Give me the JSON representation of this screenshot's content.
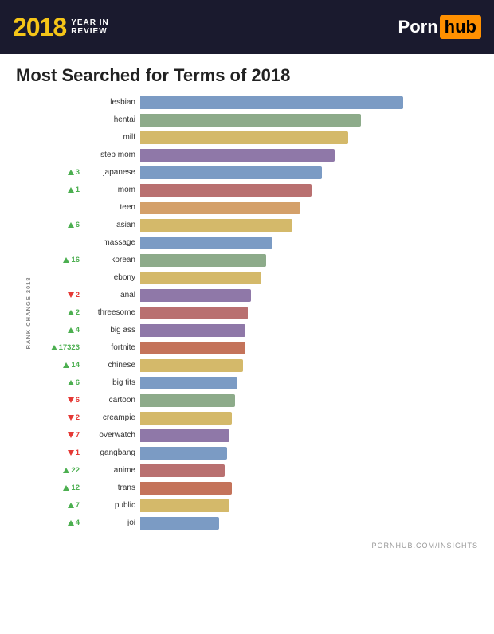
{
  "header": {
    "year": "2018",
    "yearSub1": "YEAR IN",
    "yearSub2": "REVIEW",
    "logoText1": "Porn",
    "logoText2": "hub"
  },
  "title": "Most Searched for Terms of 2018",
  "footer": "PORNHUB.COM/INSIGHTS",
  "axisLabel": "RANK CHANGE 2018",
  "bars": [
    {
      "term": "lesbian",
      "rankChange": null,
      "dir": "none",
      "pct": 100,
      "color": "#7b9bc4"
    },
    {
      "term": "hentai",
      "rankChange": null,
      "dir": "none",
      "pct": 84,
      "color": "#8dab8a"
    },
    {
      "term": "milf",
      "rankChange": null,
      "dir": "none",
      "pct": 79,
      "color": "#d4b96a"
    },
    {
      "term": "step mom",
      "rankChange": null,
      "dir": "none",
      "pct": 74,
      "color": "#8f78a8"
    },
    {
      "term": "japanese",
      "rankChange": 3,
      "dir": "up",
      "pct": 69,
      "color": "#7b9bc4"
    },
    {
      "term": "mom",
      "rankChange": 1,
      "dir": "up",
      "pct": 65,
      "color": "#b97070"
    },
    {
      "term": "teen",
      "rankChange": null,
      "dir": "none",
      "pct": 61,
      "color": "#d4a06a"
    },
    {
      "term": "asian",
      "rankChange": 6,
      "dir": "up",
      "pct": 58,
      "color": "#d4b96a"
    },
    {
      "term": "massage",
      "rankChange": null,
      "dir": "none",
      "pct": 50,
      "color": "#7b9bc4"
    },
    {
      "term": "korean",
      "rankChange": 16,
      "dir": "up",
      "pct": 48,
      "color": "#8dab8a"
    },
    {
      "term": "ebony",
      "rankChange": null,
      "dir": "none",
      "pct": 46,
      "color": "#d4b96a"
    },
    {
      "term": "anal",
      "rankChange": 2,
      "dir": "down",
      "pct": 42,
      "color": "#8f78a8"
    },
    {
      "term": "threesome",
      "rankChange": 2,
      "dir": "up",
      "pct": 41,
      "color": "#b97070"
    },
    {
      "term": "big ass",
      "rankChange": 4,
      "dir": "up",
      "pct": 40,
      "color": "#8f78a8"
    },
    {
      "term": "fortnite",
      "rankChange": 17323,
      "dir": "up",
      "pct": 40,
      "color": "#c4735a"
    },
    {
      "term": "chinese",
      "rankChange": 14,
      "dir": "up",
      "pct": 39,
      "color": "#d4b96a"
    },
    {
      "term": "big tits",
      "rankChange": 6,
      "dir": "up",
      "pct": 37,
      "color": "#7b9bc4"
    },
    {
      "term": "cartoon",
      "rankChange": 6,
      "dir": "down",
      "pct": 36,
      "color": "#8dab8a"
    },
    {
      "term": "creampie",
      "rankChange": 2,
      "dir": "down",
      "pct": 35,
      "color": "#d4b96a"
    },
    {
      "term": "overwatch",
      "rankChange": 7,
      "dir": "down",
      "pct": 34,
      "color": "#8f78a8"
    },
    {
      "term": "gangbang",
      "rankChange": 1,
      "dir": "down",
      "pct": 33,
      "color": "#7b9bc4"
    },
    {
      "term": "anime",
      "rankChange": 22,
      "dir": "up",
      "pct": 32,
      "color": "#b97070"
    },
    {
      "term": "trans",
      "rankChange": 12,
      "dir": "up",
      "pct": 35,
      "color": "#c4735a"
    },
    {
      "term": "public",
      "rankChange": 7,
      "dir": "up",
      "pct": 34,
      "color": "#d4b96a"
    },
    {
      "term": "joi",
      "rankChange": 4,
      "dir": "up",
      "pct": 30,
      "color": "#7b9bc4"
    }
  ]
}
